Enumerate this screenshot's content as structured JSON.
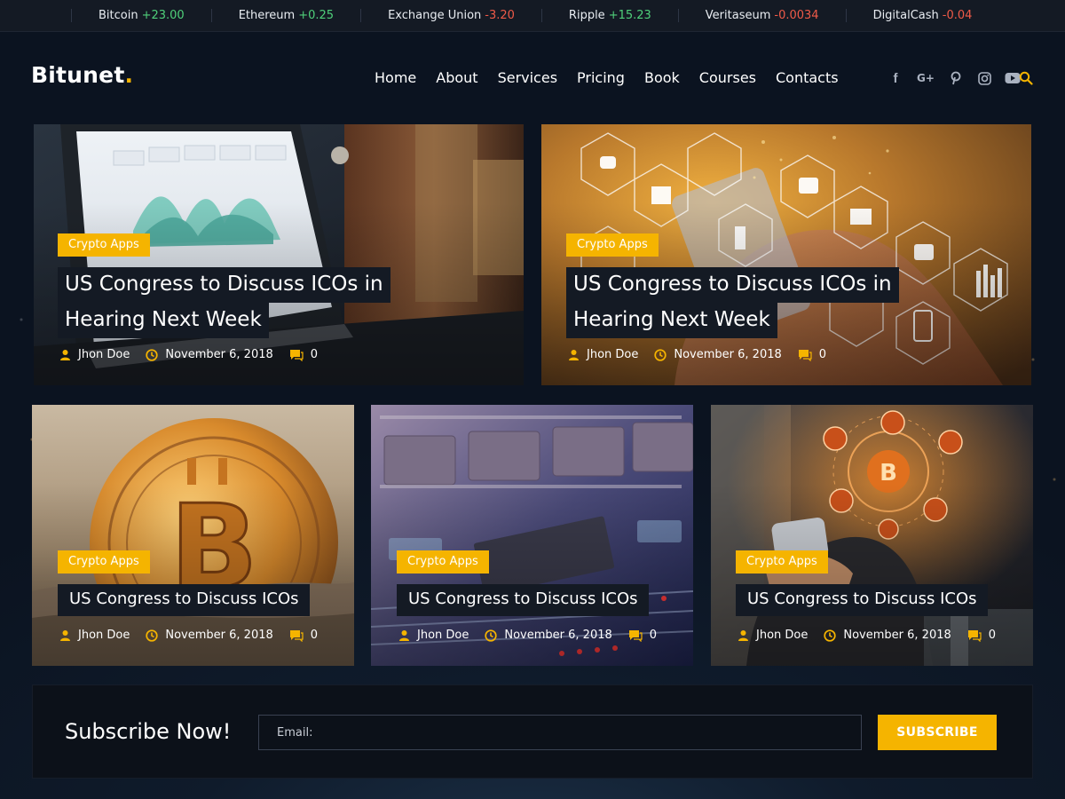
{
  "ticker": [
    {
      "name": "Bitcoin",
      "change": "+23.00",
      "dir": "up"
    },
    {
      "name": "Ethereum",
      "change": "+0.25",
      "dir": "up"
    },
    {
      "name": "Exchange Union",
      "change": "-3.20",
      "dir": "down"
    },
    {
      "name": "Ripple",
      "change": "+15.23",
      "dir": "up"
    },
    {
      "name": "Veritaseum",
      "change": "-0.0034",
      "dir": "down"
    },
    {
      "name": "DigitalCash",
      "change": "-0.04",
      "dir": "down"
    }
  ],
  "brand": {
    "name": "Bitunet",
    "dot": "."
  },
  "nav": [
    "Home",
    "About",
    "Services",
    "Pricing",
    "Book",
    "Courses",
    "Contacts"
  ],
  "social": [
    {
      "icon": "facebook-icon",
      "glyph": "f"
    },
    {
      "icon": "google-plus-icon",
      "glyph": "G+"
    },
    {
      "icon": "pinterest-icon",
      "glyph": "p"
    },
    {
      "icon": "instagram-icon",
      "glyph": ""
    },
    {
      "icon": "youtube-icon",
      "glyph": ""
    }
  ],
  "colors": {
    "accent": "#f5b400",
    "up": "#4fd07a",
    "down": "#ef5a48",
    "panel": "#141a24"
  },
  "cards": [
    {
      "category": "Crypto Apps",
      "title_lines": [
        "US Congress to Discuss ICOs in",
        "Hearing Next Week"
      ],
      "author": "Jhon Doe",
      "date": "November 6, 2018",
      "comments": "0"
    },
    {
      "category": "Crypto Apps",
      "title_lines": [
        "US Congress to Discuss ICOs in",
        "Hearing Next Week"
      ],
      "author": "Jhon Doe",
      "date": "November 6, 2018",
      "comments": "0"
    },
    {
      "category": "Crypto Apps",
      "title_lines": [
        "US Congress to Discuss ICOs"
      ],
      "author": "Jhon Doe",
      "date": "November 6, 2018",
      "comments": "0"
    },
    {
      "category": "Crypto Apps",
      "title_lines": [
        "US Congress to Discuss ICOs"
      ],
      "author": "Jhon Doe",
      "date": "November 6, 2018",
      "comments": "0"
    },
    {
      "category": "Crypto Apps",
      "title_lines": [
        "US Congress to Discuss ICOs"
      ],
      "author": "Jhon Doe",
      "date": "November 6, 2018",
      "comments": "0"
    }
  ],
  "subscribe": {
    "heading": "Subscribe Now!",
    "placeholder": "Email:",
    "button": "SUBSCRIBE"
  }
}
